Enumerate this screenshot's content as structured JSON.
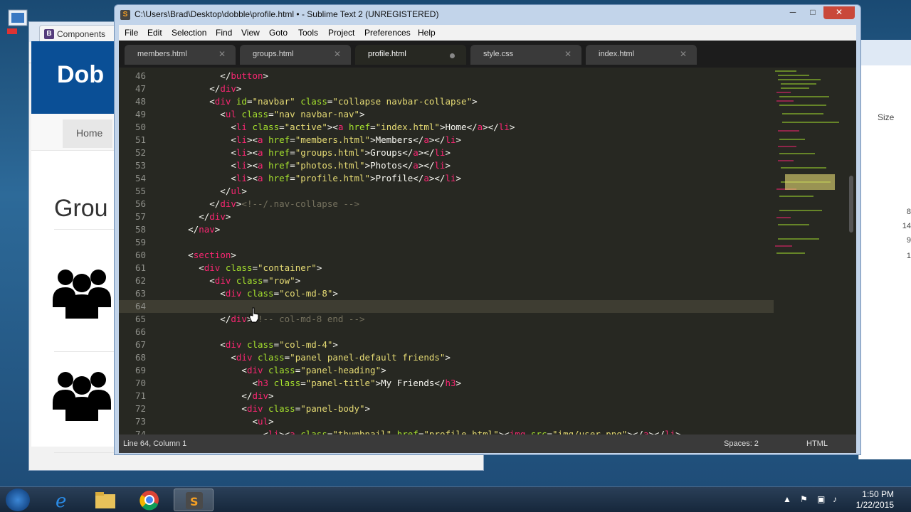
{
  "browser": {
    "tab_label": "Components",
    "tab_icon": "B",
    "hero_text": "Dob",
    "nav_home": "Home",
    "page_heading": "Grou"
  },
  "right_window": {
    "column_header": "Size",
    "values": [
      "8",
      "14",
      "9",
      "1"
    ]
  },
  "sublime": {
    "title": "C:\\Users\\Brad\\Desktop\\dobble\\profile.html • - Sublime Text 2 (UNREGISTERED)",
    "menu": [
      "File",
      "Edit",
      "Selection",
      "Find",
      "View",
      "Goto",
      "Tools",
      "Project",
      "Preferences",
      "Help"
    ],
    "tabs": [
      {
        "label": "members.html"
      },
      {
        "label": "groups.html"
      },
      {
        "label": "profile.html"
      },
      {
        "label": "style.css"
      },
      {
        "label": "index.html"
      }
    ],
    "active_tab": "profile.html",
    "highlighted_line": "64",
    "lines": [
      {
        "num": "46",
        "text": "            </button>"
      },
      {
        "num": "47",
        "text": "          </div>"
      },
      {
        "num": "48",
        "text": "          <div id=\"navbar\" class=\"collapse navbar-collapse\">"
      },
      {
        "num": "49",
        "text": "            <ul class=\"nav navbar-nav\">"
      },
      {
        "num": "50",
        "text": "              <li class=\"active\"><a href=\"index.html\">Home</a></li>"
      },
      {
        "num": "51",
        "text": "              <li><a href=\"members.html\">Members</a></li>"
      },
      {
        "num": "52",
        "text": "              <li><a href=\"groups.html\">Groups</a></li>"
      },
      {
        "num": "53",
        "text": "              <li><a href=\"photos.html\">Photos</a></li>"
      },
      {
        "num": "54",
        "text": "              <li><a href=\"profile.html\">Profile</a></li>"
      },
      {
        "num": "55",
        "text": "            </ul>"
      },
      {
        "num": "56",
        "text": "          </div><!--/.nav-collapse -->"
      },
      {
        "num": "57",
        "text": "        </div>"
      },
      {
        "num": "58",
        "text": "      </nav>"
      },
      {
        "num": "59",
        "text": ""
      },
      {
        "num": "60",
        "text": "      <section>"
      },
      {
        "num": "61",
        "text": "        <div class=\"container\">"
      },
      {
        "num": "62",
        "text": "          <div class=\"row\">"
      },
      {
        "num": "63",
        "text": "            <div class=\"col-md-8\">"
      },
      {
        "num": "64",
        "text": ""
      },
      {
        "num": "65",
        "text": "            </div><!-- col-md-8 end -->"
      },
      {
        "num": "66",
        "text": ""
      },
      {
        "num": "67",
        "text": "            <div class=\"col-md-4\">"
      },
      {
        "num": "68",
        "text": "              <div class=\"panel panel-default friends\">"
      },
      {
        "num": "69",
        "text": "                <div class=\"panel-heading\">"
      },
      {
        "num": "70",
        "text": "                  <h3 class=\"panel-title\">My Friends</h3>"
      },
      {
        "num": "71",
        "text": "                </div>"
      },
      {
        "num": "72",
        "text": "                <div class=\"panel-body\">"
      },
      {
        "num": "73",
        "text": "                  <ul>"
      },
      {
        "num": "74",
        "text": "                    <li><a class=\"thumbnail\" href=\"profile.html\"><img src=\"img/user.png\"></a></li>"
      }
    ],
    "status_position": "Line 64, Column 1",
    "status_spaces": "Spaces: 2",
    "status_syntax": "HTML"
  },
  "taskbar": {
    "time": "1:50 PM",
    "date": "1/22/2015"
  },
  "colors": {
    "editor_bg": "#272822",
    "tag": "#f92672",
    "attribute": "#a6e22e",
    "string": "#e6db74",
    "comment": "#75715e"
  }
}
